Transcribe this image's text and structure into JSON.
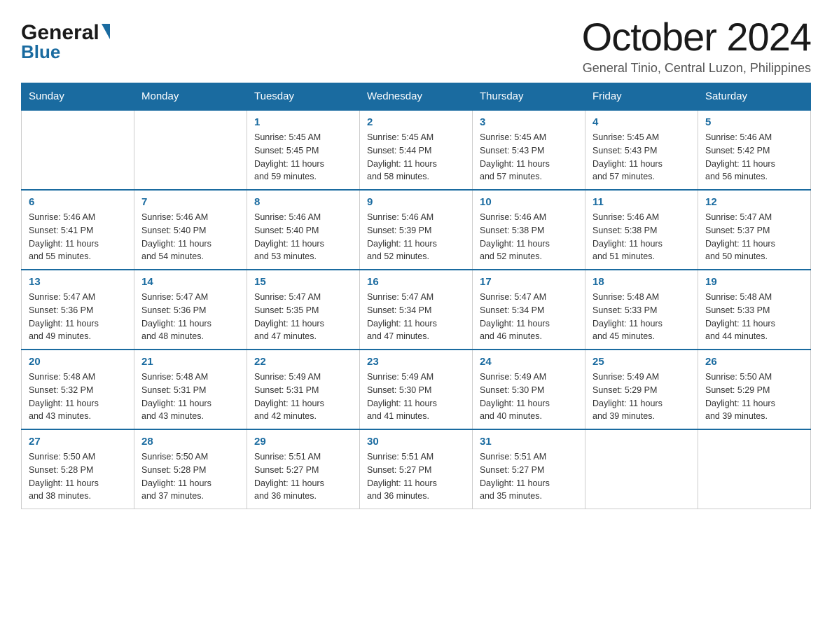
{
  "header": {
    "logo_general": "General",
    "logo_blue": "Blue",
    "month_title": "October 2024",
    "subtitle": "General Tinio, Central Luzon, Philippines"
  },
  "calendar": {
    "days_of_week": [
      "Sunday",
      "Monday",
      "Tuesday",
      "Wednesday",
      "Thursday",
      "Friday",
      "Saturday"
    ],
    "weeks": [
      [
        {
          "day": "",
          "info": ""
        },
        {
          "day": "",
          "info": ""
        },
        {
          "day": "1",
          "info": "Sunrise: 5:45 AM\nSunset: 5:45 PM\nDaylight: 11 hours\nand 59 minutes."
        },
        {
          "day": "2",
          "info": "Sunrise: 5:45 AM\nSunset: 5:44 PM\nDaylight: 11 hours\nand 58 minutes."
        },
        {
          "day": "3",
          "info": "Sunrise: 5:45 AM\nSunset: 5:43 PM\nDaylight: 11 hours\nand 57 minutes."
        },
        {
          "day": "4",
          "info": "Sunrise: 5:45 AM\nSunset: 5:43 PM\nDaylight: 11 hours\nand 57 minutes."
        },
        {
          "day": "5",
          "info": "Sunrise: 5:46 AM\nSunset: 5:42 PM\nDaylight: 11 hours\nand 56 minutes."
        }
      ],
      [
        {
          "day": "6",
          "info": "Sunrise: 5:46 AM\nSunset: 5:41 PM\nDaylight: 11 hours\nand 55 minutes."
        },
        {
          "day": "7",
          "info": "Sunrise: 5:46 AM\nSunset: 5:40 PM\nDaylight: 11 hours\nand 54 minutes."
        },
        {
          "day": "8",
          "info": "Sunrise: 5:46 AM\nSunset: 5:40 PM\nDaylight: 11 hours\nand 53 minutes."
        },
        {
          "day": "9",
          "info": "Sunrise: 5:46 AM\nSunset: 5:39 PM\nDaylight: 11 hours\nand 52 minutes."
        },
        {
          "day": "10",
          "info": "Sunrise: 5:46 AM\nSunset: 5:38 PM\nDaylight: 11 hours\nand 52 minutes."
        },
        {
          "day": "11",
          "info": "Sunrise: 5:46 AM\nSunset: 5:38 PM\nDaylight: 11 hours\nand 51 minutes."
        },
        {
          "day": "12",
          "info": "Sunrise: 5:47 AM\nSunset: 5:37 PM\nDaylight: 11 hours\nand 50 minutes."
        }
      ],
      [
        {
          "day": "13",
          "info": "Sunrise: 5:47 AM\nSunset: 5:36 PM\nDaylight: 11 hours\nand 49 minutes."
        },
        {
          "day": "14",
          "info": "Sunrise: 5:47 AM\nSunset: 5:36 PM\nDaylight: 11 hours\nand 48 minutes."
        },
        {
          "day": "15",
          "info": "Sunrise: 5:47 AM\nSunset: 5:35 PM\nDaylight: 11 hours\nand 47 minutes."
        },
        {
          "day": "16",
          "info": "Sunrise: 5:47 AM\nSunset: 5:34 PM\nDaylight: 11 hours\nand 47 minutes."
        },
        {
          "day": "17",
          "info": "Sunrise: 5:47 AM\nSunset: 5:34 PM\nDaylight: 11 hours\nand 46 minutes."
        },
        {
          "day": "18",
          "info": "Sunrise: 5:48 AM\nSunset: 5:33 PM\nDaylight: 11 hours\nand 45 minutes."
        },
        {
          "day": "19",
          "info": "Sunrise: 5:48 AM\nSunset: 5:33 PM\nDaylight: 11 hours\nand 44 minutes."
        }
      ],
      [
        {
          "day": "20",
          "info": "Sunrise: 5:48 AM\nSunset: 5:32 PM\nDaylight: 11 hours\nand 43 minutes."
        },
        {
          "day": "21",
          "info": "Sunrise: 5:48 AM\nSunset: 5:31 PM\nDaylight: 11 hours\nand 43 minutes."
        },
        {
          "day": "22",
          "info": "Sunrise: 5:49 AM\nSunset: 5:31 PM\nDaylight: 11 hours\nand 42 minutes."
        },
        {
          "day": "23",
          "info": "Sunrise: 5:49 AM\nSunset: 5:30 PM\nDaylight: 11 hours\nand 41 minutes."
        },
        {
          "day": "24",
          "info": "Sunrise: 5:49 AM\nSunset: 5:30 PM\nDaylight: 11 hours\nand 40 minutes."
        },
        {
          "day": "25",
          "info": "Sunrise: 5:49 AM\nSunset: 5:29 PM\nDaylight: 11 hours\nand 39 minutes."
        },
        {
          "day": "26",
          "info": "Sunrise: 5:50 AM\nSunset: 5:29 PM\nDaylight: 11 hours\nand 39 minutes."
        }
      ],
      [
        {
          "day": "27",
          "info": "Sunrise: 5:50 AM\nSunset: 5:28 PM\nDaylight: 11 hours\nand 38 minutes."
        },
        {
          "day": "28",
          "info": "Sunrise: 5:50 AM\nSunset: 5:28 PM\nDaylight: 11 hours\nand 37 minutes."
        },
        {
          "day": "29",
          "info": "Sunrise: 5:51 AM\nSunset: 5:27 PM\nDaylight: 11 hours\nand 36 minutes."
        },
        {
          "day": "30",
          "info": "Sunrise: 5:51 AM\nSunset: 5:27 PM\nDaylight: 11 hours\nand 36 minutes."
        },
        {
          "day": "31",
          "info": "Sunrise: 5:51 AM\nSunset: 5:27 PM\nDaylight: 11 hours\nand 35 minutes."
        },
        {
          "day": "",
          "info": ""
        },
        {
          "day": "",
          "info": ""
        }
      ]
    ]
  },
  "colors": {
    "header_bg": "#1a6ba0",
    "day_number": "#1a6ba0",
    "border": "#ccc",
    "text": "#333"
  }
}
